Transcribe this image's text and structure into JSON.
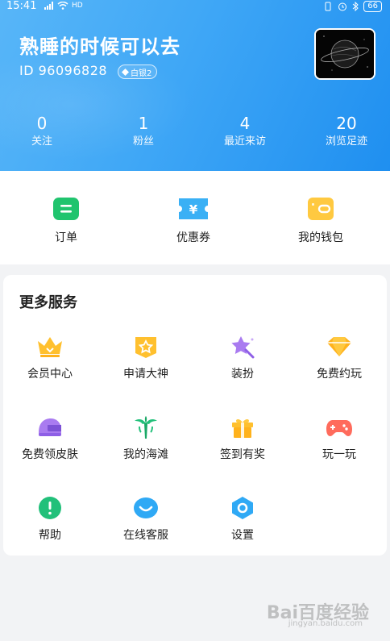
{
  "status_bar": {
    "time": "15:41",
    "network": "HD",
    "battery": "66"
  },
  "profile": {
    "nickname": "熟睡的时候可以去",
    "id_text": "ID 96096828",
    "level_badge": "白银2"
  },
  "stats": [
    {
      "value": "0",
      "label": "关注"
    },
    {
      "value": "1",
      "label": "粉丝"
    },
    {
      "value": "4",
      "label": "最近来访"
    },
    {
      "value": "20",
      "label": "浏览足迹"
    }
  ],
  "quick_actions": [
    {
      "label": "订单",
      "icon": "order-icon",
      "color": "#20c46e"
    },
    {
      "label": "优惠券",
      "icon": "coupon-icon",
      "color": "#3ab0f5"
    },
    {
      "label": "我的钱包",
      "icon": "wallet-icon",
      "color": "#ffc940"
    }
  ],
  "services": {
    "title": "更多服务",
    "items": [
      {
        "label": "会员中心",
        "icon": "crown-icon",
        "color": "#ffc02e"
      },
      {
        "label": "申请大神",
        "icon": "star-badge-icon",
        "color": "#ffc02e"
      },
      {
        "label": "装扮",
        "icon": "magic-star-icon",
        "color": "#a97bf0"
      },
      {
        "label": "免费约玩",
        "icon": "diamond-icon",
        "color": "#ffb21c"
      },
      {
        "label": "免费领皮肤",
        "icon": "helmet-icon",
        "color": "#a97bf0"
      },
      {
        "label": "我的海滩",
        "icon": "palm-tree-icon",
        "color": "#22c07a"
      },
      {
        "label": "签到有奖",
        "icon": "gift-icon",
        "color": "#ffc02e"
      },
      {
        "label": "玩一玩",
        "icon": "gamepad-icon",
        "color": "#ff6b5c"
      },
      {
        "label": "帮助",
        "icon": "help-icon",
        "color": "#22c07a"
      },
      {
        "label": "在线客服",
        "icon": "customer-service-icon",
        "color": "#2fa9f5"
      },
      {
        "label": "设置",
        "icon": "settings-icon",
        "color": "#2fa9f5"
      }
    ]
  },
  "watermark": {
    "text": "Bai百度经验",
    "sub": "jingyan.baidu.com"
  }
}
